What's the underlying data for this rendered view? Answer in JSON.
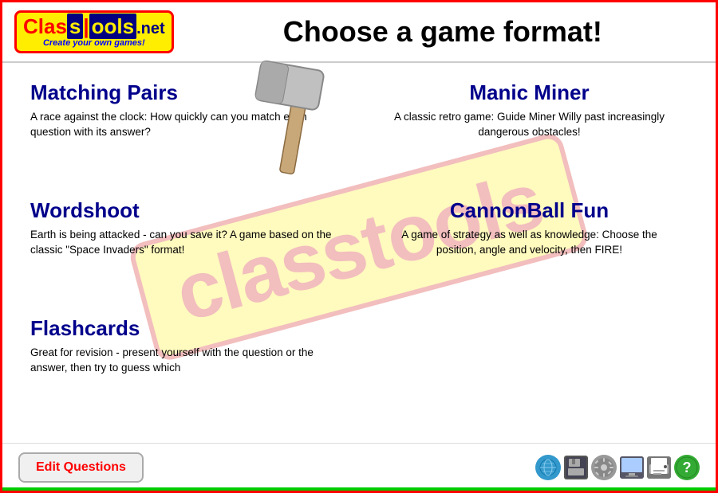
{
  "header": {
    "logo": {
      "line1": "ClassTools",
      "tagline": "Create your own games!"
    },
    "title": "Choose a game format!"
  },
  "watermark": {
    "text": "classtools"
  },
  "games": [
    {
      "id": "matching-pairs",
      "title": "Matching Pairs",
      "description": "A race against the clock: How quickly can you match each question with its answer?",
      "position": "left"
    },
    {
      "id": "manic-miner",
      "title": "Manic Miner",
      "description": "A classic retro game: Guide Miner Willy past increasingly dangerous obstacles!",
      "position": "right"
    },
    {
      "id": "wordshoot",
      "title": "Wordshoot",
      "description": "Earth is being attacked - can you save it? A game based on the classic \"Space Invaders\" format!",
      "position": "left"
    },
    {
      "id": "cannonball-fun",
      "title": "CannonBall Fun",
      "description": "A game of strategy as well as knowledge: Choose the position, angle and velocity, then FIRE!",
      "position": "right"
    },
    {
      "id": "flashcards",
      "title": "Flashcards",
      "description": "Great for revision - present yourself with the question or the answer, then try to guess which",
      "position": "left"
    }
  ],
  "bottom": {
    "edit_button": "Edit Questions",
    "icons": [
      {
        "name": "globe-icon",
        "label": "Globe"
      },
      {
        "name": "save-icon",
        "label": "Save"
      },
      {
        "name": "settings-icon",
        "label": "Settings"
      },
      {
        "name": "monitor-icon",
        "label": "Monitor"
      },
      {
        "name": "print-icon",
        "label": "Print"
      },
      {
        "name": "help-icon",
        "label": "Help"
      }
    ]
  }
}
